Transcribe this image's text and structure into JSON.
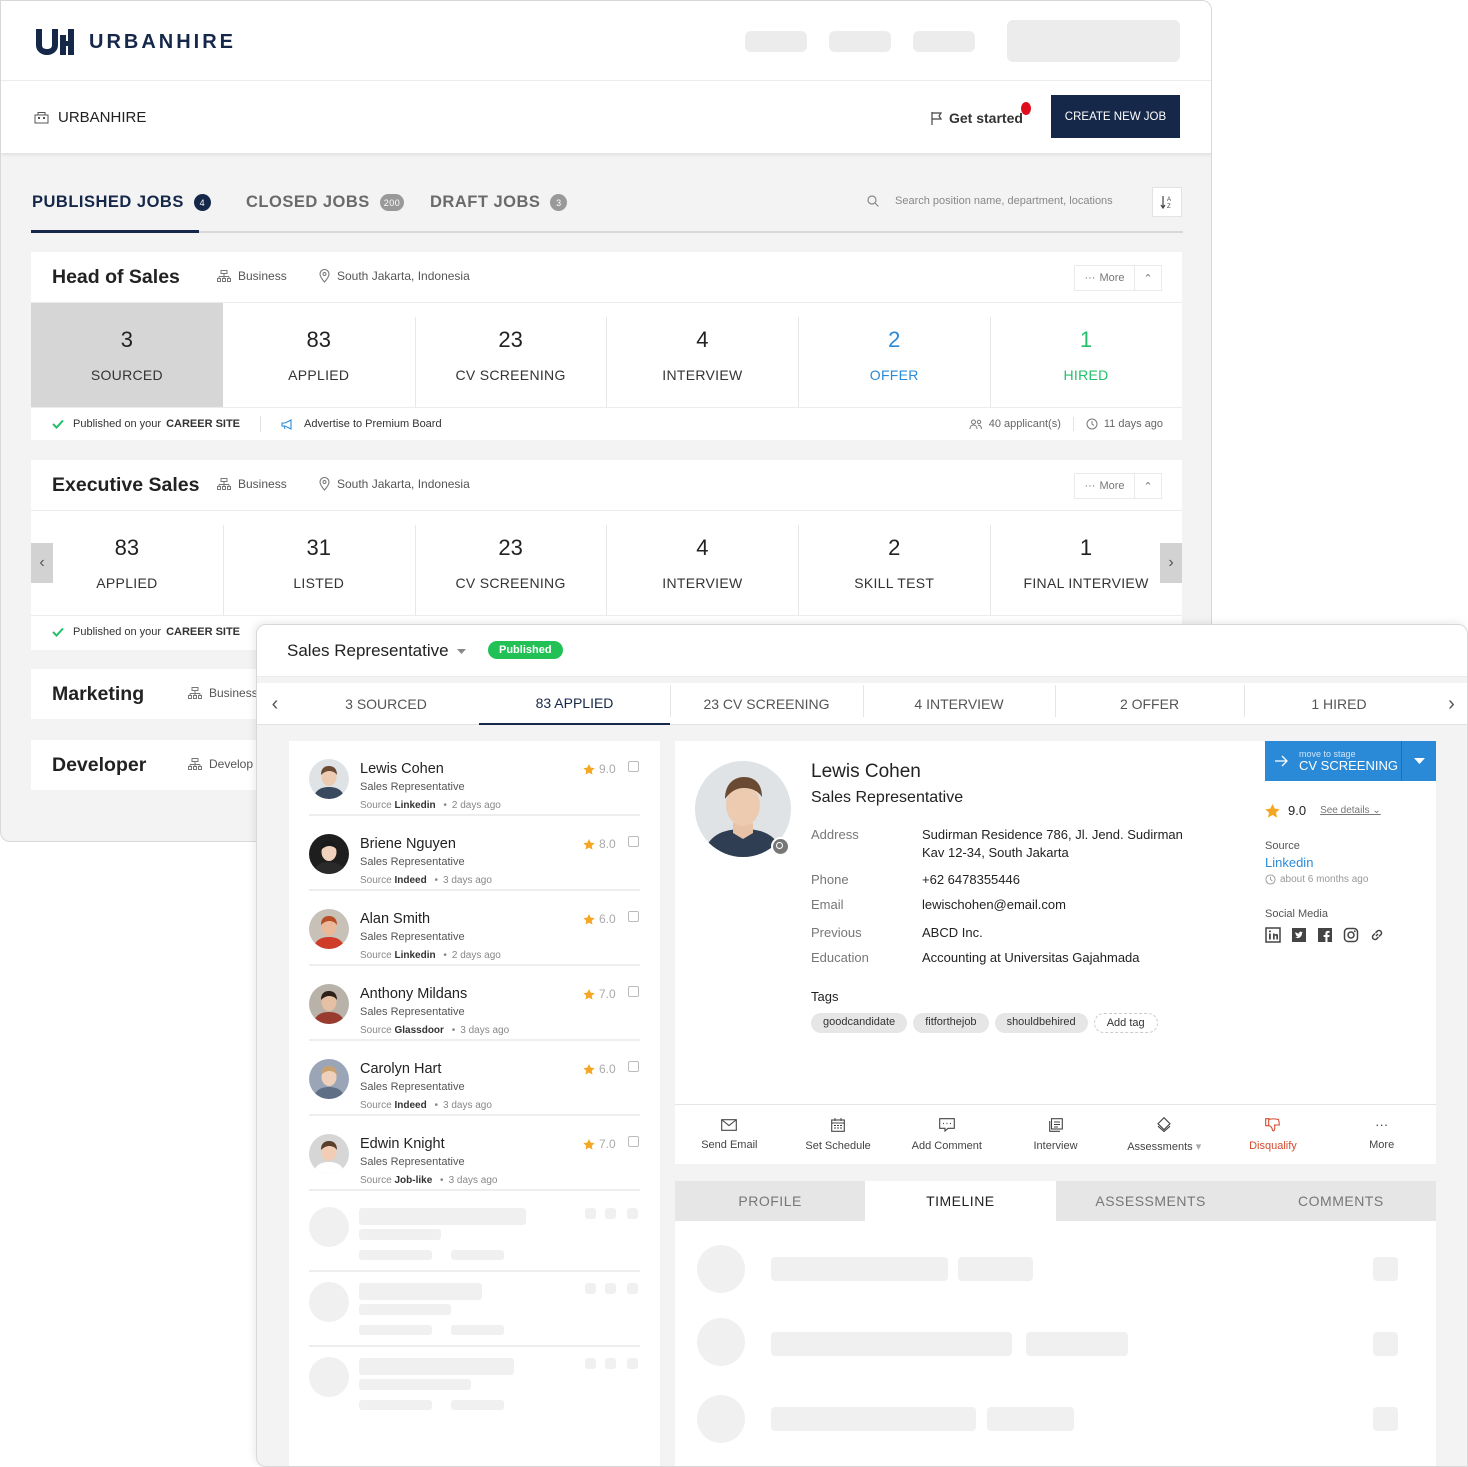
{
  "header": {
    "brand": "URBANHIRE"
  },
  "subbar": {
    "org_name": "URBANHIRE",
    "get_started": "Get started",
    "create_job": "CREATE NEW JOB"
  },
  "job_tabs": [
    {
      "label": "PUBLISHED JOBS",
      "count": "4"
    },
    {
      "label": "CLOSED JOBS",
      "count": "200"
    },
    {
      "label": "DRAFT JOBS",
      "count": "3"
    }
  ],
  "search": {
    "placeholder": "Search position name, department, locations"
  },
  "jobs": [
    {
      "title": "Head of Sales",
      "department": "Business",
      "location": "South Jakarta, Indonesia",
      "more": "More",
      "stages": [
        {
          "num": "3",
          "label": "SOURCED"
        },
        {
          "num": "83",
          "label": "APPLIED"
        },
        {
          "num": "23",
          "label": "CV SCREENING"
        },
        {
          "num": "4",
          "label": "INTERVIEW"
        },
        {
          "num": "2",
          "label": "OFFER"
        },
        {
          "num": "1",
          "label": "HIRED"
        }
      ],
      "published_prefix": "Published on your",
      "published_site": "CAREER SITE",
      "advertise": "Advertise to Premium Board",
      "applicants": "40 applicant(s)",
      "age": "11 days ago"
    },
    {
      "title": "Executive Sales",
      "department": "Business",
      "location": "South Jakarta, Indonesia",
      "more": "More",
      "stages": [
        {
          "num": "83",
          "label": "APPLIED"
        },
        {
          "num": "31",
          "label": "LISTED"
        },
        {
          "num": "23",
          "label": "CV SCREENING"
        },
        {
          "num": "4",
          "label": "INTERVIEW"
        },
        {
          "num": "2",
          "label": "SKILL TEST"
        },
        {
          "num": "1",
          "label": "FINAL INTERVIEW"
        }
      ],
      "published_prefix": "Published on your",
      "published_site": "CAREER SITE"
    },
    {
      "title": "Marketing",
      "department": "Business"
    },
    {
      "title": "Developer",
      "department": "Develop"
    }
  ],
  "panel": {
    "title": "Sales Representative",
    "status": "Published",
    "stages": [
      "3 SOURCED",
      "83 APPLIED",
      "23 CV SCREENING",
      "4 INTERVIEW",
      "2 OFFER",
      "1 HIRED"
    ],
    "candidates": [
      {
        "name": "Lewis Cohen",
        "role": "Sales Representative",
        "source_label": "Source",
        "source": "Linkedin",
        "time": "2 days ago",
        "score": "9.0"
      },
      {
        "name": "Briene Nguyen",
        "role": "Sales Representative",
        "source_label": "Source",
        "source": "Indeed",
        "time": "3 days ago",
        "score": "8.0"
      },
      {
        "name": "Alan Smith",
        "role": "Sales Representative",
        "source_label": "Source",
        "source": "Linkedin",
        "time": "2 days ago",
        "score": "6.0"
      },
      {
        "name": "Anthony Mildans",
        "role": "Sales Representative",
        "source_label": "Source",
        "source": "Glassdoor",
        "time": "3 days ago",
        "score": "7.0"
      },
      {
        "name": "Carolyn Hart",
        "role": "Sales Representative",
        "source_label": "Source",
        "source": "Indeed",
        "time": "3 days ago",
        "score": "6.0"
      },
      {
        "name": "Edwin Knight",
        "role": "Sales Representative",
        "source_label": "Source",
        "source": "Job-like",
        "time": "3 days ago",
        "score": "7.0"
      }
    ],
    "detail": {
      "name": "Lewis Cohen",
      "role": "Sales Representative",
      "fields": {
        "address_label": "Address",
        "address_1": "Sudirman Residence 786, Jl. Jend. Sudirman",
        "address_2": "Kav 12-34, South Jakarta",
        "phone_label": "Phone",
        "phone": "+62 6478355446",
        "email_label": "Email",
        "email": "lewischohen@email.com",
        "previous_label": "Previous",
        "previous": "ABCD Inc.",
        "education_label": "Education",
        "education": "Accounting at Universitas Gajahmada"
      },
      "tags_label": "Tags",
      "tags": [
        "goodcandidate",
        "fitforthejob",
        "shouldbehired"
      ],
      "add_tag": "Add tag",
      "move_small": "move to stage",
      "move_stage": "CV SCREENING",
      "score": "9.0",
      "see_details": "See details",
      "source_label": "Source",
      "source": "Linkedin",
      "source_time": "about 6 months ago",
      "social_label": "Social Media",
      "actions": [
        "Send Email",
        "Set Schedule",
        "Add Comment",
        "Interview",
        "Assessments",
        "Disqualify",
        "More"
      ]
    },
    "profile_tabs": [
      "PROFILE",
      "TIMELINE",
      "ASSESSMENTS",
      "COMMENTS"
    ]
  },
  "colors": {
    "navy": "#16284a",
    "blue": "#2b8ad8",
    "green": "#22c06a",
    "published": "#21c155",
    "red": "#e00b1c",
    "star": "#f5a623"
  }
}
